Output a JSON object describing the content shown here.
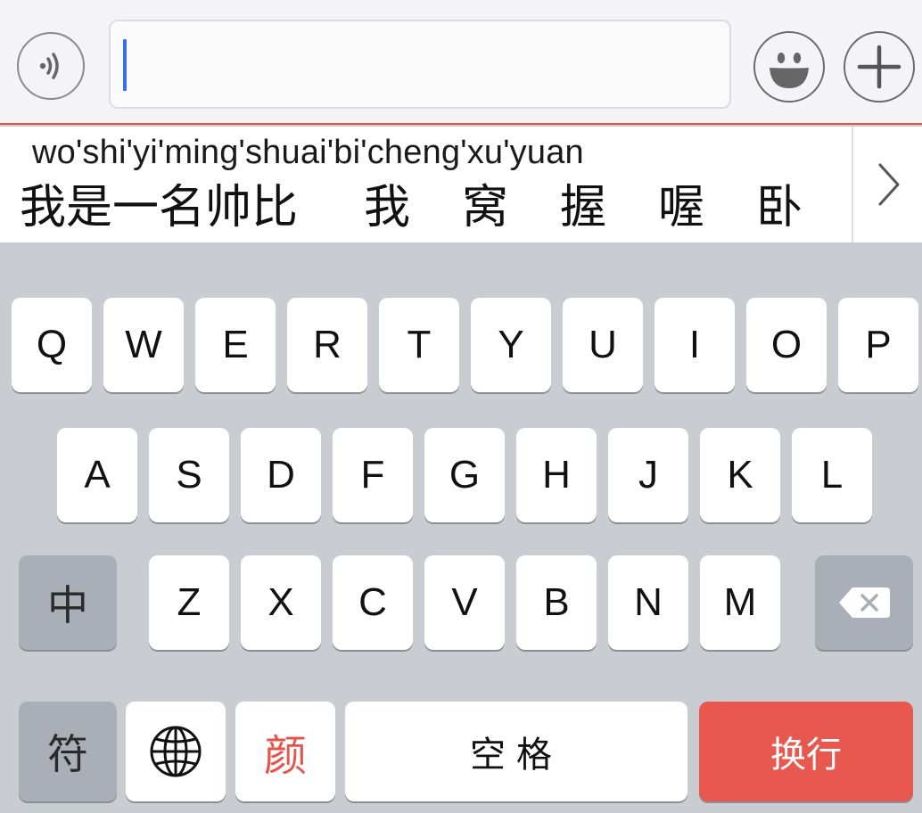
{
  "input_bar": {
    "text_value": "",
    "voice_icon": "voice-wave-icon",
    "emoji_icon": "smiley-face-icon",
    "plus_icon": "plus-icon"
  },
  "candidates": {
    "pinyin": "wo'shi'yi'ming'shuai'bi'cheng'xu'yuan",
    "items": [
      "我是一名帅比",
      "我",
      "窝",
      "握",
      "喔",
      "卧"
    ],
    "expand_icon": "chevron-right-icon"
  },
  "keyboard": {
    "row1": [
      "Q",
      "W",
      "E",
      "R",
      "T",
      "Y",
      "U",
      "I",
      "O",
      "P"
    ],
    "row2": [
      "A",
      "S",
      "D",
      "F",
      "G",
      "H",
      "J",
      "K",
      "L"
    ],
    "row3": [
      "Z",
      "X",
      "C",
      "V",
      "B",
      "N",
      "M"
    ],
    "lang_toggle": "中",
    "backspace_icon": "backspace-icon",
    "symbols": "符",
    "globe_icon": "globe-icon",
    "face_key": "颜",
    "space": "空格",
    "enter": "换行"
  },
  "colors": {
    "accent_red": "#e8584f",
    "caret_blue": "#3a6cf0",
    "keyboard_bg": "#c9ccd1",
    "dark_key": "#a9aeb7"
  }
}
